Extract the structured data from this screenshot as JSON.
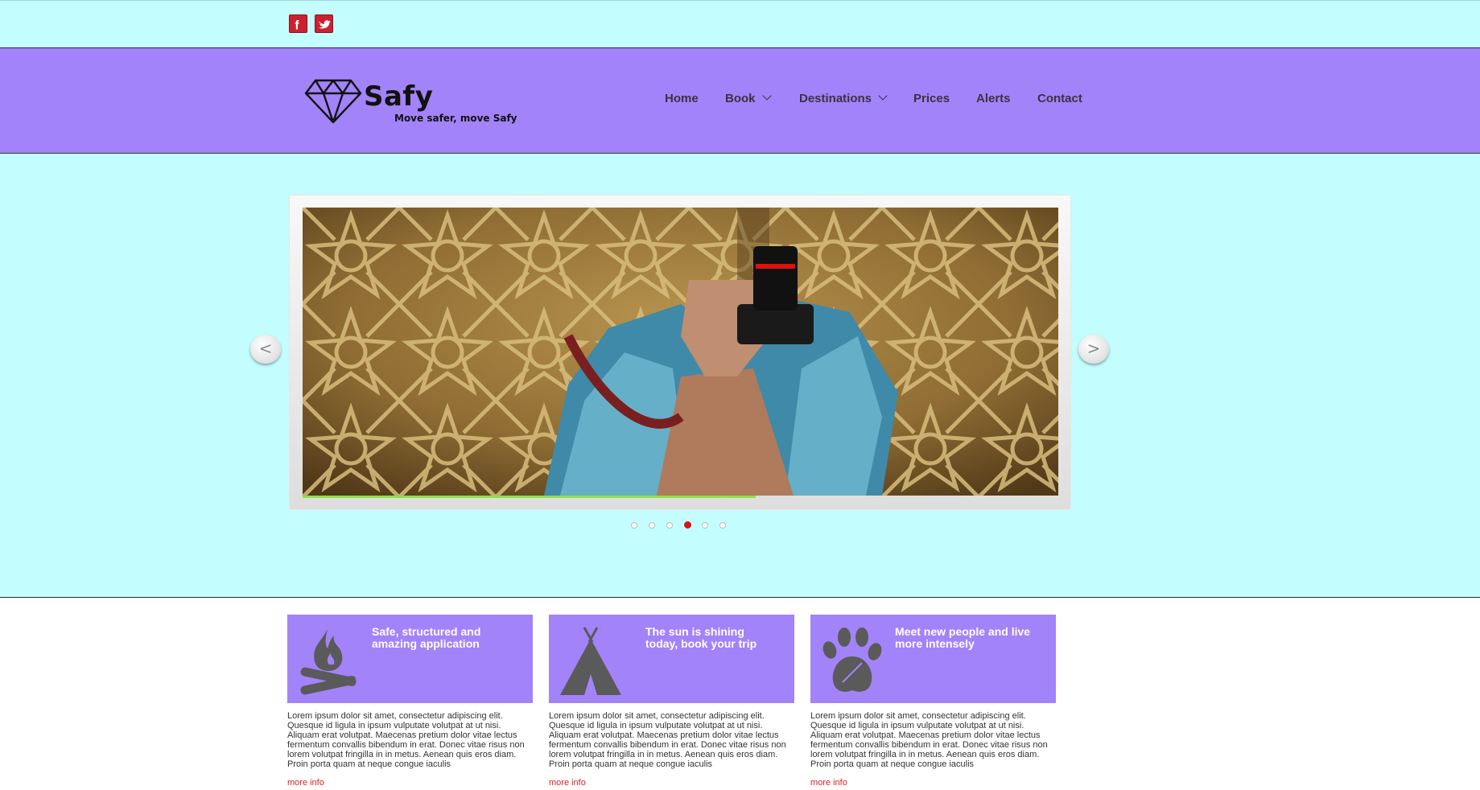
{
  "social": {
    "items": [
      {
        "name": "facebook-icon"
      },
      {
        "name": "twitter-icon"
      }
    ]
  },
  "header": {
    "logo_name": "Safy",
    "logo_tagline": "Move safer, move Safy",
    "nav": [
      {
        "label": "Home",
        "dropdown": false
      },
      {
        "label": "Book",
        "dropdown": true
      },
      {
        "label": "Destinations",
        "dropdown": true
      },
      {
        "label": "Prices",
        "dropdown": false
      },
      {
        "label": "Alerts",
        "dropdown": false
      },
      {
        "label": "Contact",
        "dropdown": false
      }
    ]
  },
  "slider": {
    "prev_label": "<",
    "next_label": ">",
    "slide_count": 6,
    "active_slide": 4,
    "progress": 0.6,
    "image": "photographer-with-camera-in-front-of-golden-door"
  },
  "features": [
    {
      "title": "Safe, structured and amazing application",
      "icon": "campfire-icon",
      "text": "Lorem ipsum dolor sit amet, consectetur adipiscing elit. Quesque id ligula in ipsum vulputate volutpat at ut nisi. Aliquam erat volutpat. Maecenas pretium dolor vitae lectus fermentum convallis bibendum in erat. Donec vitae risus non lorem volutpat fringilla in in metus. Aenean quis eros diam. Proin porta quam at neque congue iaculis",
      "link": "more info"
    },
    {
      "title": "The sun is shining today, book your trip",
      "icon": "tent-icon",
      "text": "Lorem ipsum dolor sit amet, consectetur adipiscing elit. Quesque id ligula in ipsum vulputate volutpat at ut nisi. Aliquam erat volutpat. Maecenas pretium dolor vitae lectus fermentum convallis bibendum in erat. Donec vitae risus non lorem volutpat fringilla in in metus. Aenean quis eros diam. Proin porta quam at neque congue iaculis",
      "link": "more info"
    },
    {
      "title": "Meet new people and live more intensely",
      "icon": "paw-print-icon",
      "text": "Lorem ipsum dolor sit amet, consectetur adipiscing elit. Quesque id ligula in ipsum vulputate volutpat at ut nisi. Aliquam erat volutpat. Maecenas pretium dolor vitae lectus fermentum convallis bibendum in erat. Donec vitae risus non lorem volutpat fringilla in in metus. Aenean quis eros diam. Proin porta quam at neque congue iaculis",
      "link": "more info"
    }
  ],
  "colors": {
    "page_bg": "#c4fdfd",
    "header_bg": "#a283f9",
    "feature_bg": "#a283f9",
    "link": "#e02020",
    "active_dot": "#dd1111",
    "progress": "#8ee04e"
  }
}
